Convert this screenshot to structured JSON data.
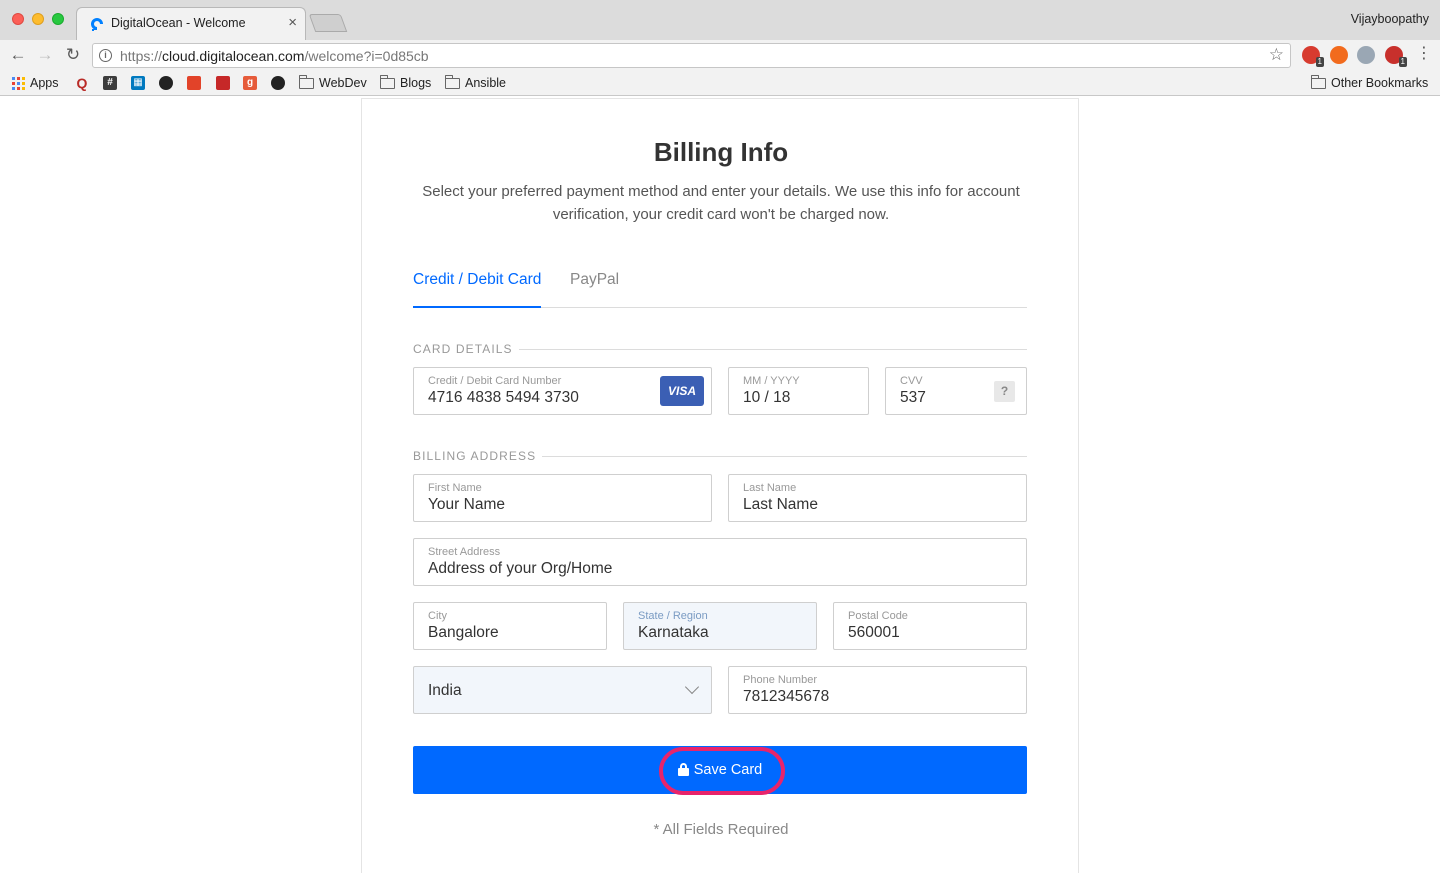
{
  "browser": {
    "tab_title": "DigitalOcean - Welcome",
    "tab_close": "×",
    "profile_name": "Vijayboopathy",
    "url_scheme": "https://",
    "url_host": "cloud.digitalocean.com",
    "url_path": "/welcome?i=0d85cb",
    "extensions": [
      {
        "icon": "extension-red-icon",
        "badge": "1"
      },
      {
        "icon": "extension-fire-icon"
      },
      {
        "icon": "extension-glasses-icon"
      },
      {
        "icon": "extension-abp-icon",
        "badge": "1"
      }
    ],
    "bookmarks": [
      {
        "label": "Apps",
        "icon": "apps-grid-icon"
      },
      {
        "label": "",
        "icon": "quora-icon"
      },
      {
        "label": "",
        "icon": "slack-icon"
      },
      {
        "label": "",
        "icon": "trello-icon"
      },
      {
        "label": "",
        "icon": "github-icon"
      },
      {
        "label": "",
        "icon": "gitlab-icon"
      },
      {
        "label": "",
        "icon": "bookmark-red-icon"
      },
      {
        "label": "",
        "icon": "g-icon"
      },
      {
        "label": "",
        "icon": "spotify-icon"
      },
      {
        "label": "WebDev",
        "icon": "folder-icon"
      },
      {
        "label": "Blogs",
        "icon": "folder-icon"
      },
      {
        "label": "Ansible",
        "icon": "folder-icon"
      }
    ],
    "other_bookmarks": "Other Bookmarks"
  },
  "page": {
    "title": "Billing Info",
    "subtitle": "Select your preferred payment method and enter your details. We use this info for account verification, your credit card won't be charged now.",
    "tabs": [
      "Credit / Debit Card",
      "PayPal"
    ],
    "active_tab": "Credit / Debit Card",
    "card_section_label": "CARD DETAILS",
    "address_section_label": "BILLING ADDRESS",
    "card_number": {
      "label": "Credit / Debit Card Number",
      "value": "4716 4838 5494 3730",
      "brand": "VISA"
    },
    "expiry": {
      "label": "MM / YYYY",
      "value": "10 / 18"
    },
    "cvv": {
      "label": "CVV",
      "value": "537",
      "help": "?"
    },
    "first_name": {
      "label": "First Name",
      "value": "Your Name"
    },
    "last_name": {
      "label": "Last Name",
      "value": "Last Name"
    },
    "street": {
      "label": "Street Address",
      "value": "Address of your Org/Home"
    },
    "city": {
      "label": "City",
      "value": "Bangalore"
    },
    "state": {
      "label": "State / Region",
      "value": "Karnataka"
    },
    "postal": {
      "label": "Postal Code",
      "value": "560001"
    },
    "country": {
      "value": "India"
    },
    "phone": {
      "label": "Phone Number",
      "value": "7812345678"
    },
    "save_button": "Save Card",
    "required_note": "* All Fields Required",
    "colors": {
      "accent": "#0069ff",
      "highlight": "#e8246b"
    }
  }
}
